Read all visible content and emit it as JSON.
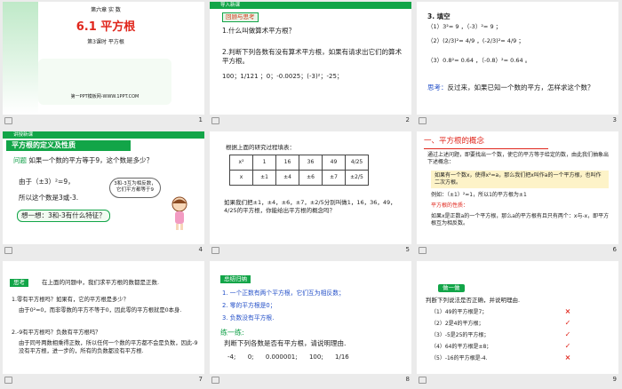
{
  "slides": [
    {
      "number": "1",
      "chapter": "第六章  实  数",
      "title": "6.1 平方根",
      "subtitle": "第3课时  平方根",
      "footer": "第一PPT模板网-WWW.1PPT.COM"
    },
    {
      "number": "2",
      "header": "导入新课",
      "tag": "回顾与思考",
      "q1": "1.什么叫做算术平方根？",
      "q2": "2.判断下列各数有没有算术平方根，如果有请求出它们的算术平方根。",
      "numbers": "100；1/121 ；0；-0.0025；(-3)²；-25；"
    },
    {
      "number": "3",
      "title": "3. 填空",
      "line1": "（1）3²= 9 ，（-3）²= 9 ；",
      "line2": "（2）(2/3)²= 4/9 ，(-2/3)²= 4/9 ；",
      "line3": "（3）0.8²= 0.64 ，（-0.8）²= 0.64 。",
      "think_label": "思考：",
      "think_text": "反过来，如果已知一个数的平方，怎样求这个数？"
    },
    {
      "number": "4",
      "header": "讲授新课",
      "section": "平方根的定义及性质",
      "problem_label": "问题",
      "problem": "如果一个数的平方等于9，这个数是多少？",
      "line_a": "由于（±3）²=9，",
      "line_b": "所以这个数是3或-3.",
      "question": "想一想：3和-3有什么特征？",
      "bubble": "3和-3互为相反数，它们平方都等于9"
    },
    {
      "number": "5",
      "intro": "根据上面的研究过程填表：",
      "row1": [
        "x²",
        "1",
        "16",
        "36",
        "49",
        "4/25"
      ],
      "row2": [
        "x",
        "±1",
        "±4",
        "±6",
        "±7",
        "±2/5"
      ],
      "conclusion": "如果我们把±1，±4，±6，±7，±2/5分别叫做1，16，36，49，4/25的平方根，你能给出平方根的概念吗？"
    },
    {
      "number": "6",
      "section": "一、平方根的概念",
      "intro": "通过上述问题，即要找出一个数，使它的平方等于给定的数，由此我们抽象出下述概念：",
      "definition": "如果有一个数x，使得x²=a，那么我们把x叫作a的一个平方根，也叫作二次方根。",
      "example": "例如：（±1）²=1，所以1的平方根为±1",
      "property_title": "平方根的性质：",
      "property": "如果x是正数a的一个平方根，那么a的平方根有且只有两个：x与-x，即平方根互为相反数。"
    },
    {
      "number": "7",
      "think_tag": "思考",
      "intro": "在上面的问题中，我们求平方根的数都是正数.",
      "q1": "1.零有平方根吗？如果有，它的平方根是多少？",
      "a1": "由于0²=0，而非零数的平方不等于0，因此零的平方根就是0本身.",
      "q2": "2.-9有平方根吗？负数有平方根吗？",
      "a2": "由于同号两数相乘得正数，所以任何一个数的平方都不会是负数，因此-9没有平方根，进一步的，所有的负数都没有平方根."
    },
    {
      "number": "8",
      "tag": "总结归纳",
      "s1": "1. 一个正数有两个平方根，它们互为相反数；",
      "s2": "2. 零的平方根是0；",
      "s3": "3. 负数没有平方根.",
      "practice": "练一练:",
      "prompt": "判断下列各数是否有平方根，请说明理由.",
      "numbers": "-4;      0;      0.000001;      100;      1/16"
    },
    {
      "number": "9",
      "tag": "做一做",
      "prompt": "判断下列说法是否正确，并说明理由.",
      "items": [
        "（1）49的平方根是7；",
        "（2）2是4的平方根；",
        "（3）-5是25的平方根；",
        "（4）64的平方根是±8；",
        "（5）-16的平方根是-4."
      ],
      "marks": [
        "×",
        "✓",
        "✓",
        "✓",
        "×"
      ]
    }
  ]
}
